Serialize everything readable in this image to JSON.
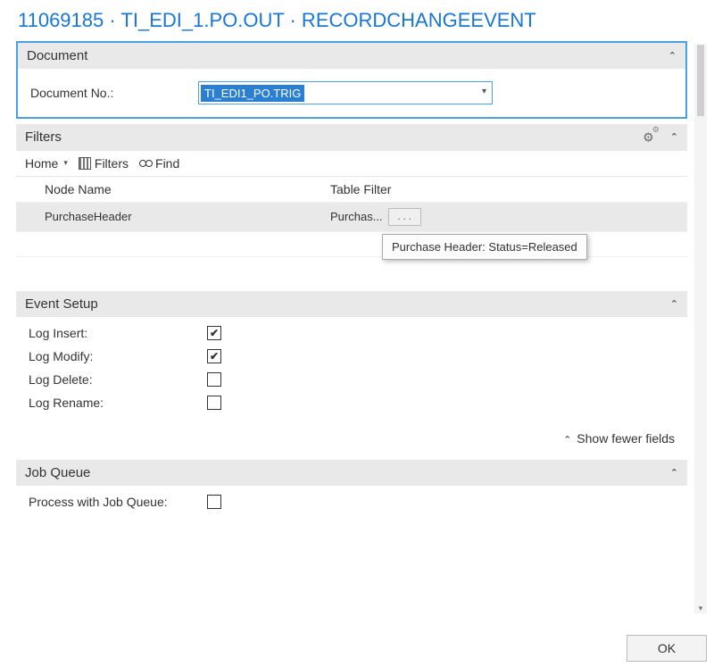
{
  "page_title": "11069185 · TI_EDI_1.PO.OUT · RECORDCHANGEEVENT",
  "document": {
    "header": "Document",
    "doc_no_label": "Document No.:",
    "doc_no_value": "TI_EDI1_PO.TRIG"
  },
  "filters": {
    "header": "Filters",
    "toolbar": {
      "home": "Home",
      "filters": "Filters",
      "find": "Find"
    },
    "columns": {
      "node": "Node Name",
      "table_filter": "Table Filter"
    },
    "rows": [
      {
        "node_name": "PurchaseHeader",
        "table_filter": "Purchas..."
      }
    ],
    "ellipsis_label": ". . .",
    "tooltip": "Purchase Header: Status=Released"
  },
  "event_setup": {
    "header": "Event Setup",
    "fields": {
      "log_insert_label": "Log Insert:",
      "log_insert_checked": true,
      "log_modify_label": "Log Modify:",
      "log_modify_checked": true,
      "log_delete_label": "Log Delete:",
      "log_delete_checked": false,
      "log_rename_label": "Log Rename:",
      "log_rename_checked": false
    },
    "show_fewer": "Show fewer fields"
  },
  "job_queue": {
    "header": "Job Queue",
    "process_label": "Process with Job Queue:",
    "process_checked": false
  },
  "footer": {
    "ok": "OK"
  }
}
